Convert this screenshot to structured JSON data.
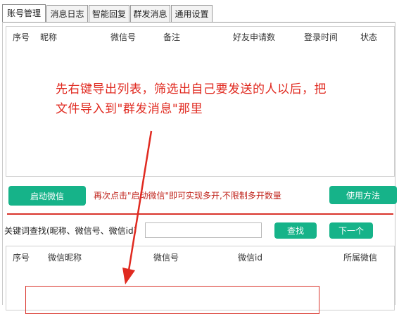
{
  "tabs": [
    {
      "label": "账号管理",
      "active": true
    },
    {
      "label": "消息日志",
      "active": false
    },
    {
      "label": "智能回复",
      "active": false
    },
    {
      "label": "群发消息",
      "active": false
    },
    {
      "label": "通用设置",
      "active": false
    }
  ],
  "account_table": {
    "columns": [
      "序号",
      "昵称",
      "微信号",
      "备注",
      "好友申请数",
      "登录时间",
      "状态"
    ]
  },
  "annotation": {
    "line1": "先右键导出列表，筛选出自己要发送的人以后，把",
    "line2": "文件导入到\"群发消息\"那里"
  },
  "buttons": {
    "start_wechat": "启动微信",
    "usage": "使用方法",
    "search": "查找",
    "next": "下一个"
  },
  "hint": "再次点击\"启动微信\"即可实现多开,不限制多开数量",
  "search": {
    "label": "关键词查找(昵称、微信号、微信id)",
    "value": ""
  },
  "result_table": {
    "columns": [
      "序号",
      "微信昵称",
      "微信号",
      "微信id",
      "所属微信"
    ]
  },
  "colors": {
    "accent_green": "#16b389",
    "annotation_red": "#e02a20"
  }
}
